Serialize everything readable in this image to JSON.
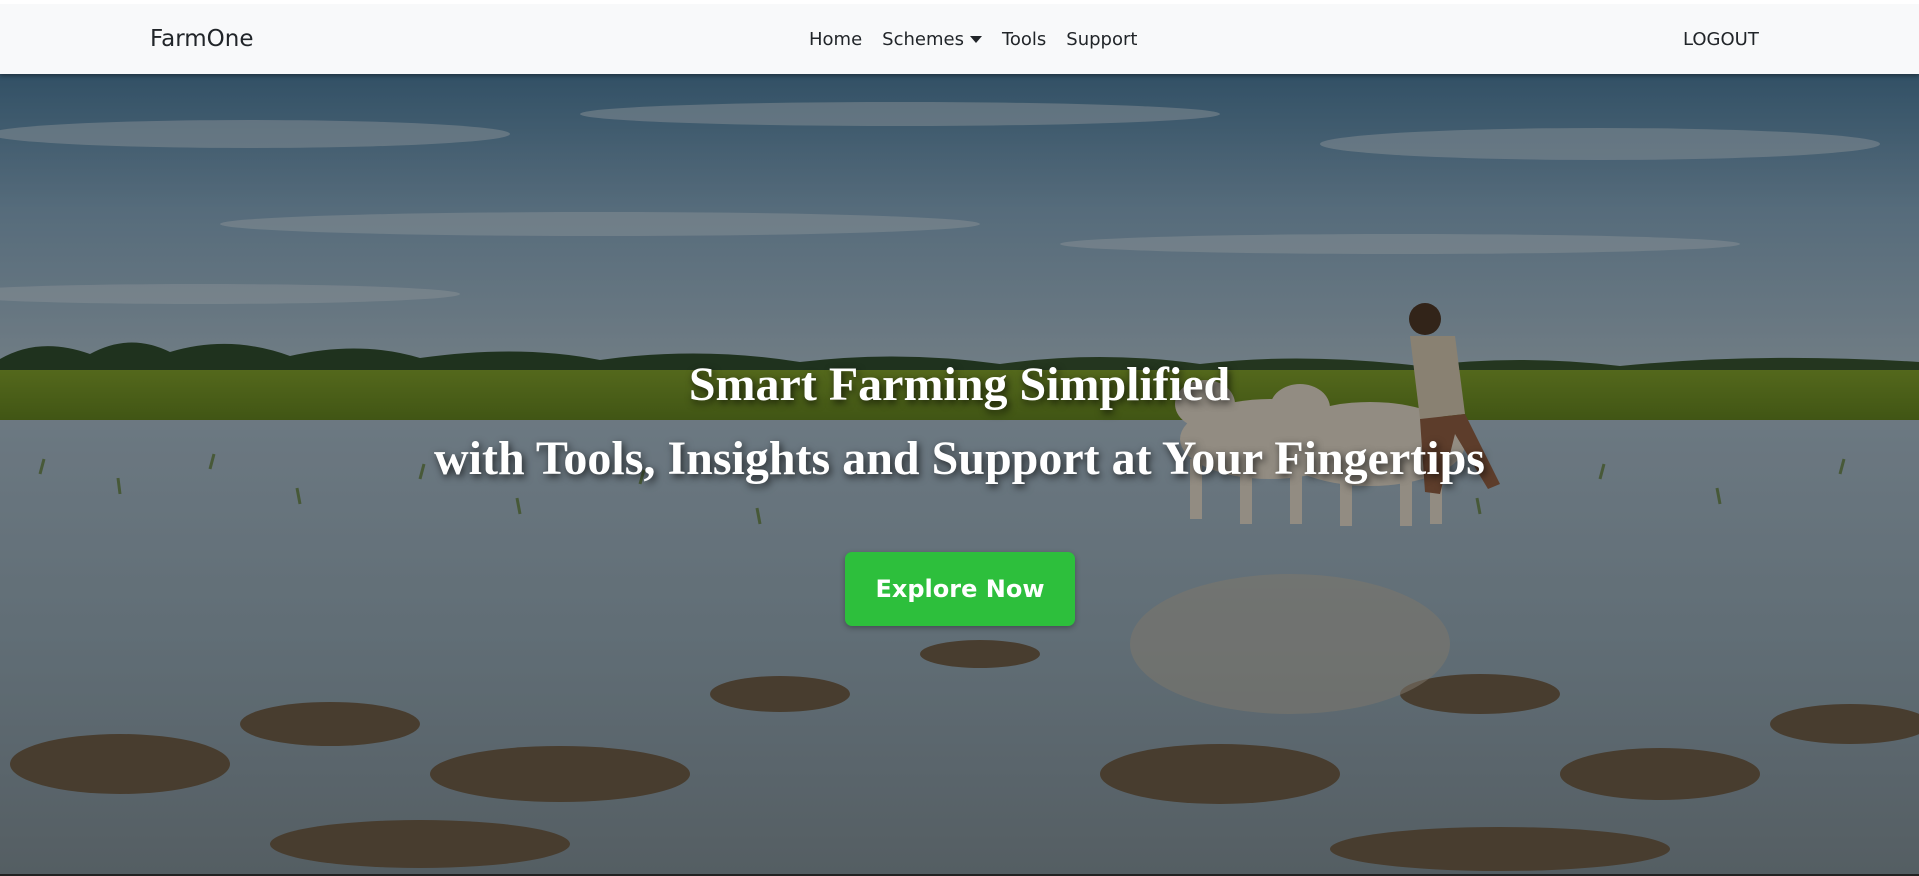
{
  "navbar": {
    "brand": "FarmOne",
    "links": [
      {
        "label": "Home"
      },
      {
        "label": "Schemes",
        "has_dropdown": true
      },
      {
        "label": "Tools"
      },
      {
        "label": "Support"
      }
    ],
    "logout_label": "LOGOUT"
  },
  "hero": {
    "title_line1": "Smart Farming Simplified",
    "title_line2": "with Tools, Insights and Support at Your Fingertips",
    "cta_label": "Explore Now",
    "background_image": "farmer-plowing-rice-field-with-oxen",
    "cta_color": "#2dbf3c"
  }
}
